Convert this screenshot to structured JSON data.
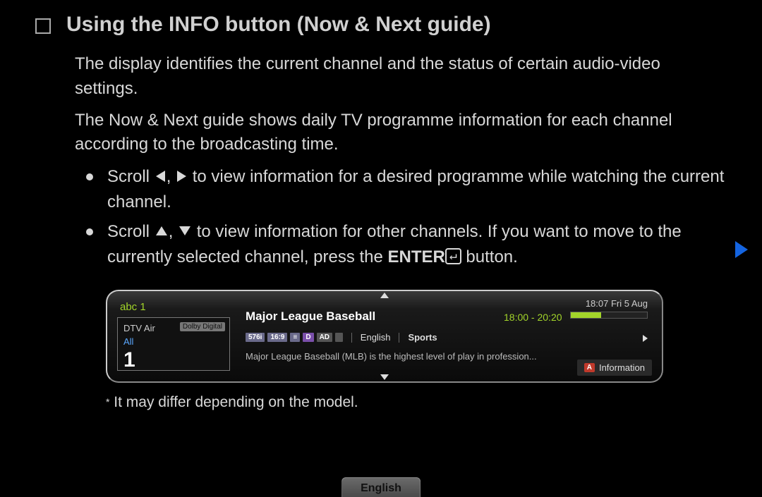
{
  "title": "Using the INFO button (Now & Next guide)",
  "para1": "The display identifies the current channel and the status of certain audio-video settings.",
  "para2": "The Now & Next guide shows daily TV programme information for each channel according to the broadcasting time.",
  "bullet1_a": "Scroll ",
  "bullet1_b": " to view information for a desired programme while watching the current channel.",
  "bullet2_a": "Scroll ",
  "bullet2_b": " to view information for other channels. If you want to move to the currently selected channel, press the ",
  "bullet2_enter": "ENTER",
  "bullet2_c": " button.",
  "guide": {
    "clock": "18:07 Fri 5 Aug",
    "channel_name": "abc 1",
    "dtv": "DTV Air",
    "dolby": "Dolby Digital",
    "all": "All",
    "channel_number": "1",
    "prog_title": "Major League Baseball",
    "prog_time": "18:00 - 20:20",
    "badges": {
      "res": "576i",
      "aspect": "16:9",
      "lines": "≡",
      "d": "D",
      "ad": "AD"
    },
    "lang": "English",
    "genre": "Sports",
    "desc": "Major League Baseball (MLB) is the highest level of play in profession...",
    "info_a": "A",
    "info_label": "Information"
  },
  "footnote": " It may differ depending on the model.",
  "page_lang": "English"
}
